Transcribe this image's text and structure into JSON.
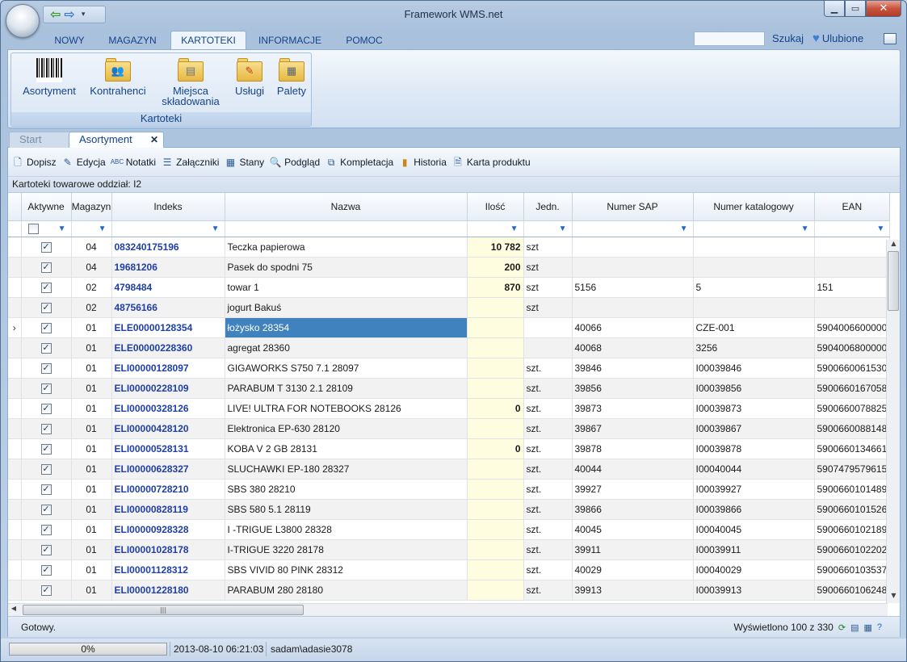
{
  "window": {
    "title": "Framework WMS.net"
  },
  "ribbon_tabs": [
    "NOWY",
    "MAGAZYN",
    "KARTOTEKI",
    "INFORMACJE",
    "POMOC"
  ],
  "search_label": "Szukaj",
  "favorites_label": "Ulubione",
  "ribbon_group": {
    "caption": "Kartoteki",
    "buttons": [
      {
        "label": "Asortyment",
        "icon": "barcode-icon"
      },
      {
        "label": "Kontrahenci",
        "icon": "contacts-folder-icon"
      },
      {
        "label1": "Miejsca",
        "label2": "składowania",
        "icon": "database-folder-icon"
      },
      {
        "label": "Usługi",
        "icon": "services-folder-icon"
      },
      {
        "label": "Palety",
        "icon": "pallets-folder-icon"
      }
    ]
  },
  "doc_tabs": {
    "start": "Start",
    "active": "Asortyment"
  },
  "toolbar": [
    "Dopisz",
    "Edycja",
    "Notatki",
    "Załączniki",
    "Stany",
    "Podgląd",
    "Kompletacja",
    "Historia",
    "Karta produktu"
  ],
  "subheader": "Kartoteki towarowe oddział: I2",
  "columns": [
    "Aktywne",
    "Magazyn",
    "Indeks",
    "Nazwa",
    "Ilość",
    "Jedn.",
    "Numer SAP",
    "Numer katalogowy",
    "EAN"
  ],
  "rows": [
    [
      "04",
      "083240175196",
      "Teczka papierowa",
      "10 782",
      "szt",
      "",
      "",
      ""
    ],
    [
      "04",
      "19681206",
      "Pasek do spodni 75",
      "200",
      "szt",
      "",
      "",
      ""
    ],
    [
      "02",
      "4798484",
      "towar 1",
      "870",
      "szt",
      "5156",
      "5",
      "151"
    ],
    [
      "02",
      "48756166",
      "jogurt Bakuś",
      "",
      "szt",
      "",
      "",
      ""
    ],
    [
      "01",
      "ELE00000128354",
      "łożysko 28354",
      "",
      "",
      "40066",
      "CZE-001",
      "5904006600000"
    ],
    [
      "01",
      "ELE00000228360",
      "agregat 28360",
      "",
      "",
      "40068",
      "3256",
      "5904006800000"
    ],
    [
      "01",
      "ELI00000128097",
      "GIGAWORKS S750 7.1 28097",
      "",
      "szt.",
      "39846",
      "I00039846",
      "5900660061530"
    ],
    [
      "01",
      "ELI00000228109",
      "PARABUM T 3130 2.1 28109",
      "",
      "szt.",
      "39856",
      "I00039856",
      "5900660167058"
    ],
    [
      "01",
      "ELI00000328126",
      "LIVE! ULTRA FOR NOTEBOOKS 28126",
      "0",
      "szt.",
      "39873",
      "I00039873",
      "5900660078825"
    ],
    [
      "01",
      "ELI00000428120",
      "Elektronica EP-630 28120",
      "",
      "szt.",
      "39867",
      "I00039867",
      "5900660088148"
    ],
    [
      "01",
      "ELI00000528131",
      "KOBA V 2 GB 28131",
      "0",
      "szt.",
      "39878",
      "I00039878",
      "5900660134661"
    ],
    [
      "01",
      "ELI00000628327",
      "SLUCHAWKI EP-180 28327",
      "",
      "szt.",
      "40044",
      "I00040044",
      "5907479579615"
    ],
    [
      "01",
      "ELI00000728210",
      "SBS 380 28210",
      "",
      "szt.",
      "39927",
      "I00039927",
      "5900660101489"
    ],
    [
      "01",
      "ELI00000828119",
      "SBS 580 5.1 28119",
      "",
      "szt.",
      "39866",
      "I00039866",
      "5900660101526"
    ],
    [
      "01",
      "ELI00000928328",
      "I -TRIGUE L3800 28328",
      "",
      "szt.",
      "40045",
      "I00040045",
      "5900660102189"
    ],
    [
      "01",
      "ELI00001028178",
      "I-TRIGUE 3220 28178",
      "",
      "szt.",
      "39911",
      "I00039911",
      "5900660102202"
    ],
    [
      "01",
      "ELI00001128312",
      "SBS VIVID 80 PINK 28312",
      "",
      "szt.",
      "40029",
      "I00040029",
      "5900660103537"
    ],
    [
      "01",
      "ELI00001228180",
      "PARABUM 280 28180",
      "",
      "szt.",
      "39913",
      "I00039913",
      "5900660106248"
    ]
  ],
  "selected_row": 4,
  "status": {
    "ready": "Gotowy.",
    "shown": "Wyświetlono 100 z 330"
  },
  "bottom": {
    "progress": "0%",
    "datetime": "2013-08-10 06:21:03",
    "user": "sadam\\adasie3078"
  },
  "colors": {
    "accent": "#15428b",
    "selection": "#3f82be",
    "qty_bg": "#fffde0",
    "index_text": "#1f3fa6"
  }
}
